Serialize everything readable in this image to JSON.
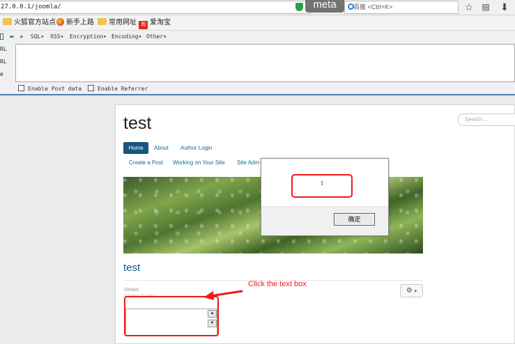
{
  "browser": {
    "url": "27.0.0.1/joomla/",
    "overlay_label": "meta",
    "search_placeholder": "百度 <Ctrl+K>",
    "toolbar_icons": [
      "shield-icon",
      "star-icon",
      "reading-list-icon",
      "download-icon"
    ]
  },
  "bookmarks": [
    {
      "label": "火狐官方站点",
      "icon": "folder-icon"
    },
    {
      "label": "新手上路",
      "icon": "firefox-icon"
    },
    {
      "label": "常用网址",
      "icon": "folder-icon"
    },
    {
      "label": "爱淘宝",
      "icon": "taobao-icon"
    }
  ],
  "hackbar": {
    "menu": [
      "SQL▾",
      "XSS▾",
      "Encryption▾",
      "Encoding▾",
      "Other▾"
    ],
    "side_labels": [
      "RL",
      "RL",
      "e"
    ],
    "enable_post": "Enable Post data",
    "enable_referrer": "Enable Referrer"
  },
  "site": {
    "title": "test",
    "search_placeholder": "Search ...",
    "nav_row1": [
      "Home",
      "About",
      "Author Login"
    ],
    "nav_row2": [
      "Create a Post",
      "Working on Your Site",
      "Site Adm"
    ],
    "article_title": "test",
    "details_label": "Details",
    "details_author": "Written by test"
  },
  "dialog": {
    "message": "1",
    "ok_label": "确定"
  },
  "annotation": {
    "label": "Click the text box",
    "color": "#f21818"
  }
}
